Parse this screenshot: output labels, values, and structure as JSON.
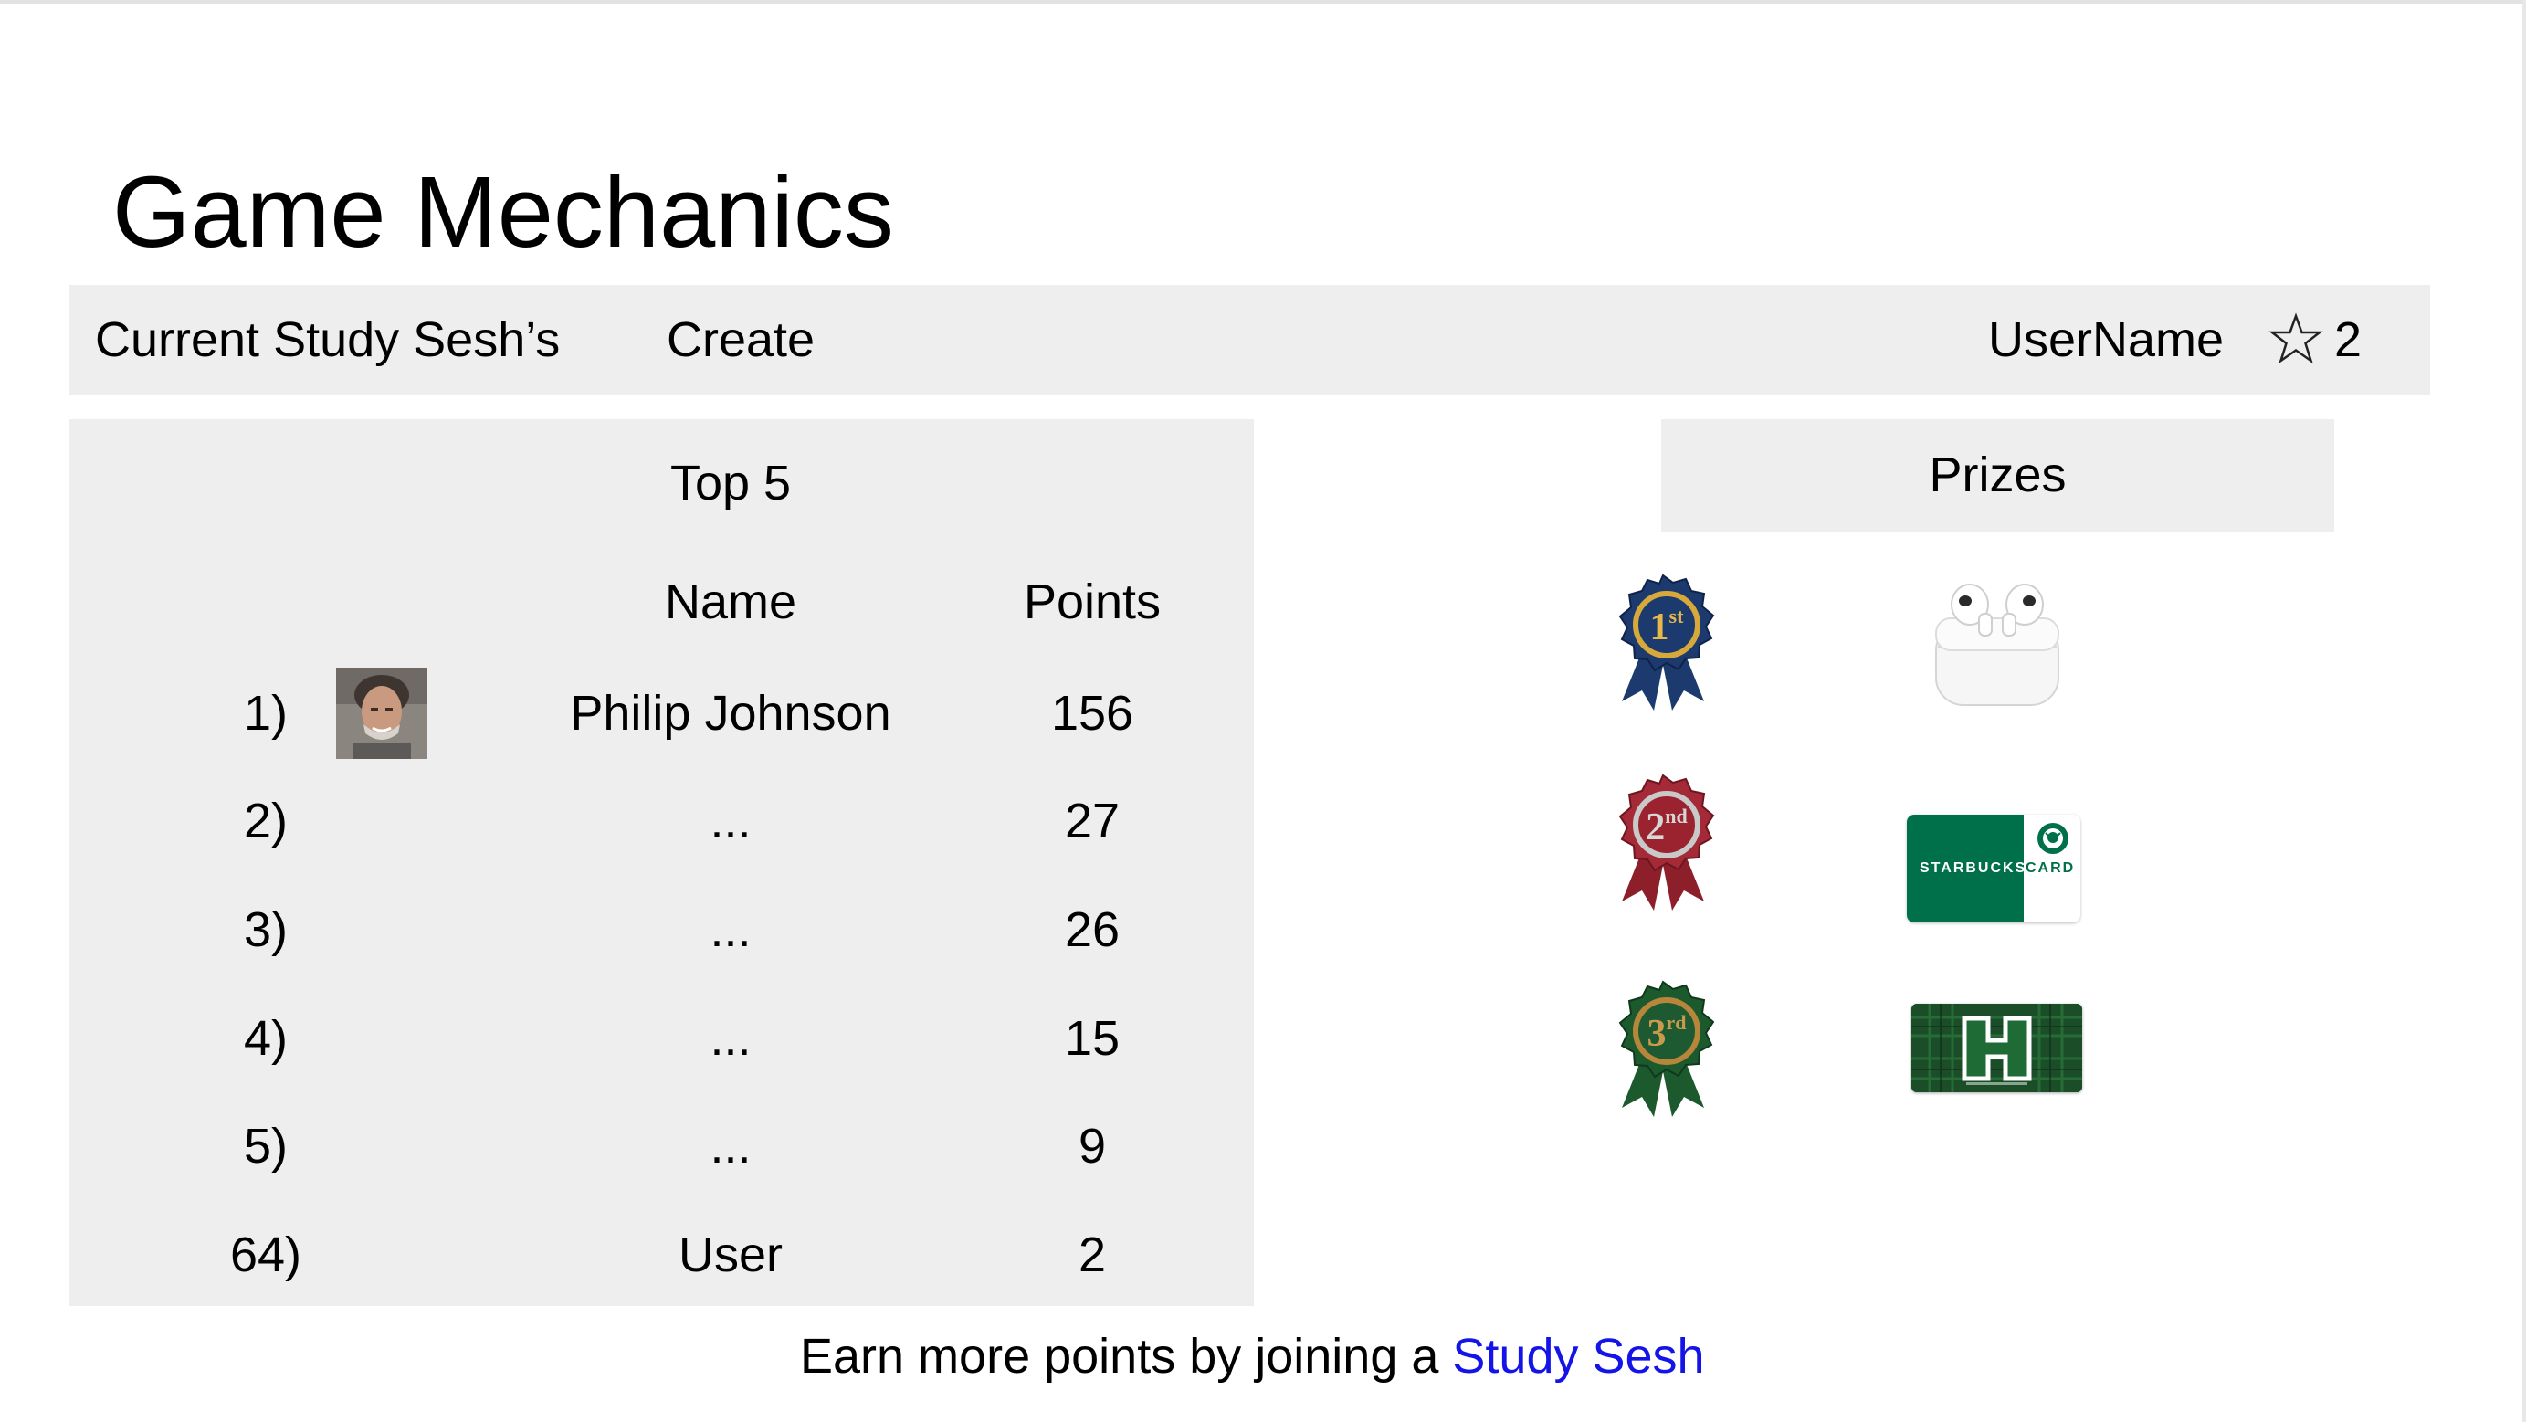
{
  "page": {
    "title": "Game Mechanics"
  },
  "nav": {
    "current_label": "Current Study Sesh’s",
    "create_label": "Create",
    "username": "UserName",
    "star_icon": "star-outline-icon",
    "points": "2"
  },
  "leaderboard": {
    "title": "Top 5",
    "headers": {
      "name": "Name",
      "points": "Points"
    },
    "rows": [
      {
        "rank": "1)",
        "name": "Philip Johnson",
        "points": "156"
      },
      {
        "rank": "2)",
        "name": "...",
        "points": "27"
      },
      {
        "rank": "3)",
        "name": "...",
        "points": "26"
      },
      {
        "rank": "4)",
        "name": "...",
        "points": "15"
      },
      {
        "rank": "5)",
        "name": "...",
        "points": "9"
      },
      {
        "rank": "64)",
        "name": "User",
        "points": "2"
      }
    ]
  },
  "prizes": {
    "title": "Prizes",
    "medals": [
      {
        "place": "1",
        "suffix": "st",
        "color": "#1d3a6e",
        "ribbon": "#1d3a6e"
      },
      {
        "place": "2",
        "suffix": "nd",
        "color": "#8d1f2b",
        "ribbon": "#8d1f2b"
      },
      {
        "place": "3",
        "suffix": "rd",
        "color": "#1c5a2e",
        "ribbon": "#1c5a2e"
      }
    ],
    "items": {
      "starbucks_brand": "STARBUCKS",
      "starbucks_card": "CARD",
      "starbucks_color": "#00704a",
      "uh_color": "#024731"
    }
  },
  "footer": {
    "text": "Earn more points by joining a ",
    "link": "Study Sesh"
  }
}
